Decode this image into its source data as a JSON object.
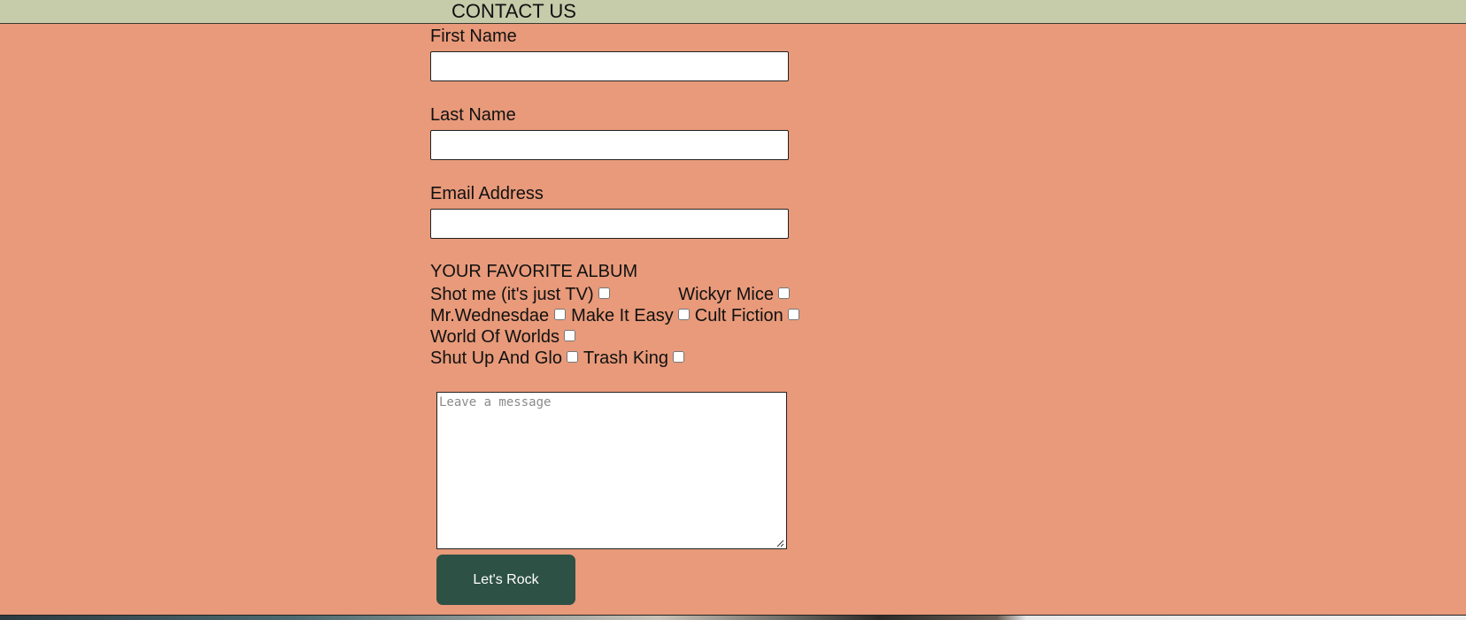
{
  "header": {
    "title": "CONTACT US"
  },
  "form": {
    "first_name": {
      "label": "First Name",
      "value": ""
    },
    "last_name": {
      "label": "Last Name",
      "value": ""
    },
    "email": {
      "label": "Email Address",
      "value": ""
    },
    "albums": {
      "heading": "YOUR FAVORITE ALBUM",
      "options": [
        {
          "label": "Shot me (it's just TV)",
          "checked": false
        },
        {
          "label": "Wickyr Mice",
          "checked": false
        },
        {
          "label": "Mr.Wednesdae",
          "checked": false
        },
        {
          "label": "Make It Easy",
          "checked": false
        },
        {
          "label": "Cult Fiction",
          "checked": false
        },
        {
          "label": "World Of Worlds",
          "checked": false
        },
        {
          "label": "Shut Up And Glo",
          "checked": false
        },
        {
          "label": "Trash King",
          "checked": false
        }
      ]
    },
    "message": {
      "placeholder": "Leave a message",
      "value": ""
    },
    "submit_label": "Let's Rock"
  },
  "colors": {
    "background": "#e89a7a",
    "header_band": "#c6ccaa",
    "button": "#2e5145"
  }
}
